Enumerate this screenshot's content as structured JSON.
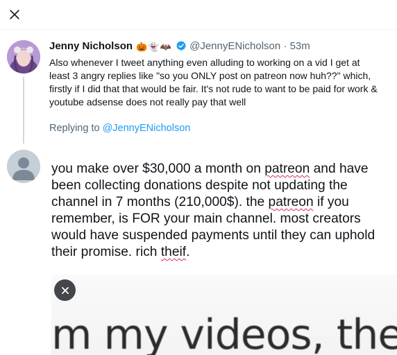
{
  "icons": {
    "close": "close-icon",
    "verified": "verified-badge-icon",
    "remove_media": "close-icon",
    "avatar_placeholder": "default-avatar-icon"
  },
  "colors": {
    "accent": "#1d9bf0",
    "secondary_text": "#536471",
    "primary_text": "#0f1419",
    "thread_line": "#cfd9de",
    "misspelling": "#e0245e"
  },
  "original_tweet": {
    "name": "Jenny Nicholson",
    "emojis": [
      "🎃",
      "👻",
      "🦇"
    ],
    "handle": "@JennyENicholson",
    "separator": "·",
    "time": "53m",
    "text": "Also whenever I tweet anything even alluding to working on a vid I get at least 3 angry replies like \"so you ONLY post on patreon now huh??\" which, firstly if I did that that would be fair. It's not rude to want to be paid for work & youtube adsense does not really pay that well"
  },
  "replying": {
    "label": "Replying to",
    "mention": "@JennyENicholson"
  },
  "reply": {
    "segments": [
      "you make over $30,000 a month on ",
      "patreon",
      " and have been collecting donations despite not updating the channel in 7 months (210,000$). the ",
      "patreon",
      " if you remember, is FOR your main channel. most creators would have suspended payments until they can uphold their promise. rich ",
      "theif",
      "."
    ]
  },
  "media": {
    "caption_text": "m my videos, the n"
  }
}
